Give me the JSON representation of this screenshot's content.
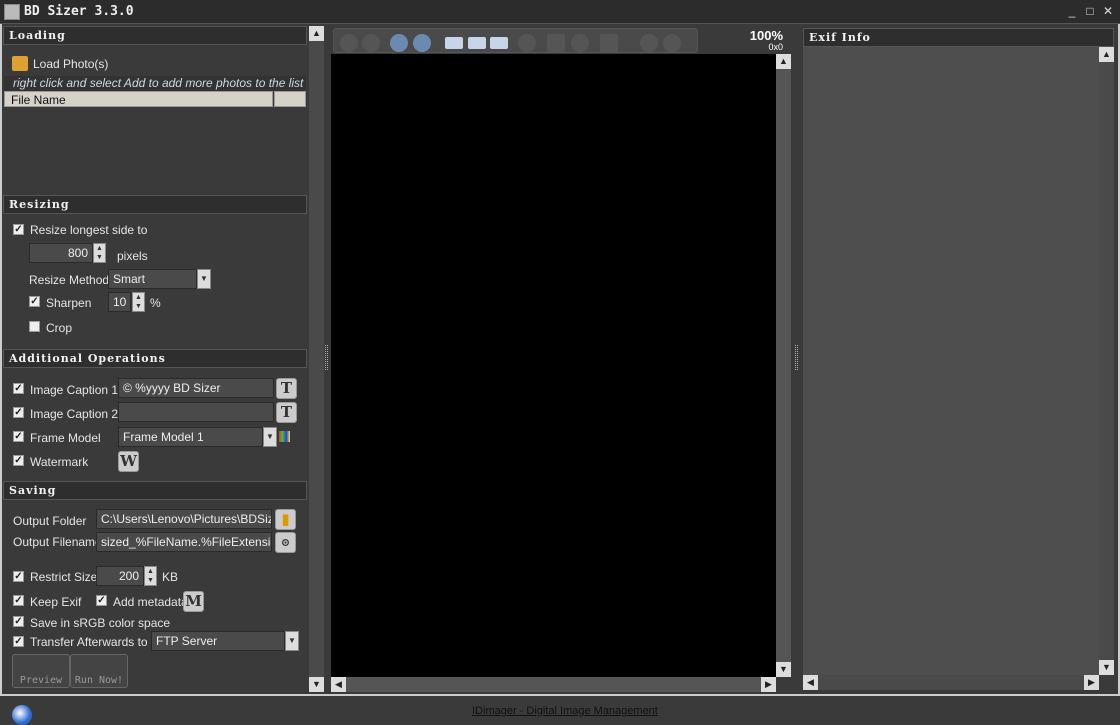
{
  "window": {
    "title": "BD Sizer 3.3.0",
    "minimize": "_",
    "maximize": "□",
    "close": "✕"
  },
  "loading": {
    "header": "Loading",
    "load_label": "Load Photo(s)",
    "hint": "right click and select Add to add more photos to the list",
    "col_file_name": "File Name"
  },
  "resizing": {
    "header": "Resizing",
    "resize_label": "Resize longest side to",
    "resize_checked": true,
    "size_value": "800",
    "size_unit": "pixels",
    "method_label": "Resize Method",
    "method_value": "Smart",
    "sharpen_label": "Sharpen",
    "sharpen_checked": true,
    "sharpen_value": "10",
    "sharpen_unit": "%",
    "crop_label": "Crop",
    "crop_checked": false
  },
  "additional": {
    "header": "Additional Operations",
    "caption1_label": "Image Caption 1",
    "caption1_value": "© %yyyy BD Sizer",
    "caption2_label": "Image Caption 2",
    "caption2_value": "",
    "frame_label": "Frame Model",
    "frame_value": "Frame Model 1",
    "watermark_label": "Watermark",
    "text_btn": "T",
    "watermark_btn": "W"
  },
  "saving": {
    "header": "Saving",
    "folder_label": "Output Folder",
    "folder_value": "C:\\Users\\Lenovo\\Pictures\\BDSizer",
    "filename_label": "Output Filename",
    "filename_value": "sized_%FileName.%FileExtension",
    "restrict_label": "Restrict Size",
    "restrict_value": "200",
    "restrict_unit": "KB",
    "keep_exif_label": "Keep Exif",
    "add_metadata_label": "Add metadata",
    "metadata_btn": "M",
    "srgb_label": "Save in sRGB color space",
    "transfer_label": "Transfer Afterwards to",
    "transfer_value": "FTP Server",
    "preview_btn": "Preview",
    "run_btn": "Run Now!"
  },
  "viewer": {
    "zoom": "100%",
    "dimensions": "0x0"
  },
  "exif": {
    "header": "Exif Info"
  },
  "footer": {
    "link": "IDimager - Digital Image Management"
  },
  "colors": {
    "accent": "#2e2e2e",
    "canvas": "#000000"
  }
}
